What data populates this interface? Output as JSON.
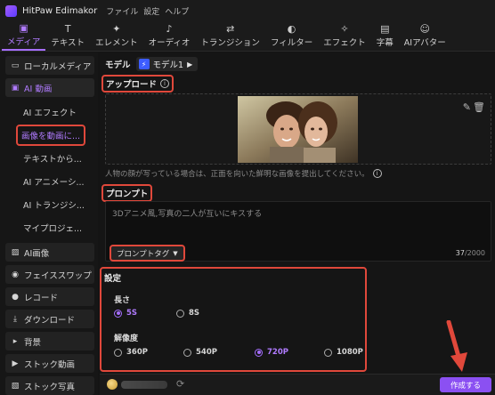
{
  "app": {
    "title": "HitPaw Edimakor",
    "menus": [
      "ファイル",
      "設定",
      "ヘルプ"
    ]
  },
  "toolbar": [
    {
      "label": "メディア",
      "icon": "media-icon",
      "glyph": "▣",
      "active": true
    },
    {
      "label": "テキスト",
      "icon": "text-icon",
      "glyph": "T",
      "active": false
    },
    {
      "label": "エレメント",
      "icon": "element-icon",
      "glyph": "✦",
      "active": false
    },
    {
      "label": "オーディオ",
      "icon": "audio-icon",
      "glyph": "♪",
      "active": false
    },
    {
      "label": "トランジション",
      "icon": "transition-icon",
      "glyph": "⇄",
      "active": false
    },
    {
      "label": "フィルター",
      "icon": "filter-icon",
      "glyph": "◐",
      "active": false
    },
    {
      "label": "エフェクト",
      "icon": "effect-icon",
      "glyph": "✧",
      "active": false
    },
    {
      "label": "字幕",
      "icon": "subtitle-icon",
      "glyph": "▤",
      "active": false
    },
    {
      "label": "AIアバター",
      "icon": "avatar-icon",
      "glyph": "☺",
      "active": false
    }
  ],
  "sidebar": {
    "top": [
      {
        "label": "ローカルメディア",
        "glyph": "▭",
        "icon": "folder-icon"
      },
      {
        "label": "AI 動画",
        "glyph": "▣",
        "icon": "ai-video-icon"
      }
    ],
    "sub": [
      "AI エフェクト",
      "画像を動画に...",
      "テキストから...",
      "AI アニメーシ...",
      "AI トランジシ...",
      "マイプロジェ..."
    ],
    "bottom": [
      {
        "label": "AI画像",
        "glyph": "▨",
        "icon": "ai-image-icon"
      },
      {
        "label": "フェイススワップ",
        "glyph": "◉",
        "icon": "face-swap-icon"
      },
      {
        "label": "レコード",
        "glyph": "●",
        "icon": "record-icon"
      },
      {
        "label": "ダウンロード",
        "glyph": "⤓",
        "icon": "download-icon"
      },
      {
        "label": "背景",
        "glyph": "▸",
        "icon": "background-icon"
      },
      {
        "label": "ストック動画",
        "glyph": "▶",
        "icon": "stock-video-icon"
      },
      {
        "label": "ストック写真",
        "glyph": "▧",
        "icon": "stock-photo-icon"
      }
    ]
  },
  "main": {
    "model_label": "モデル",
    "model_value": "モデル1",
    "upload_title": "アップロード",
    "upload_hint": "人物の顔が写っている場合は、正面を向いた鮮明な画像を提出してください。",
    "prompt_title": "プロンプト",
    "prompt_text": "3Dアニメ風,写真の二人が互いにキスする",
    "prompt_tag_label": "プロンプトタグ",
    "char_count": "37",
    "char_max": "/2000",
    "settings_title": "設定",
    "length_label": "長さ",
    "length_options": [
      {
        "label": "5S",
        "selected": true
      },
      {
        "label": "8S",
        "selected": false
      }
    ],
    "resolution_label": "解像度",
    "resolution_options": [
      {
        "label": "360P",
        "selected": false
      },
      {
        "label": "540P",
        "selected": false
      },
      {
        "label": "720P",
        "selected": true
      },
      {
        "label": "1080P",
        "selected": false
      }
    ],
    "create_label": "作成する"
  },
  "colors": {
    "accent": "#a56eff",
    "highlight": "#e0483b",
    "button": "#8b50f2"
  }
}
